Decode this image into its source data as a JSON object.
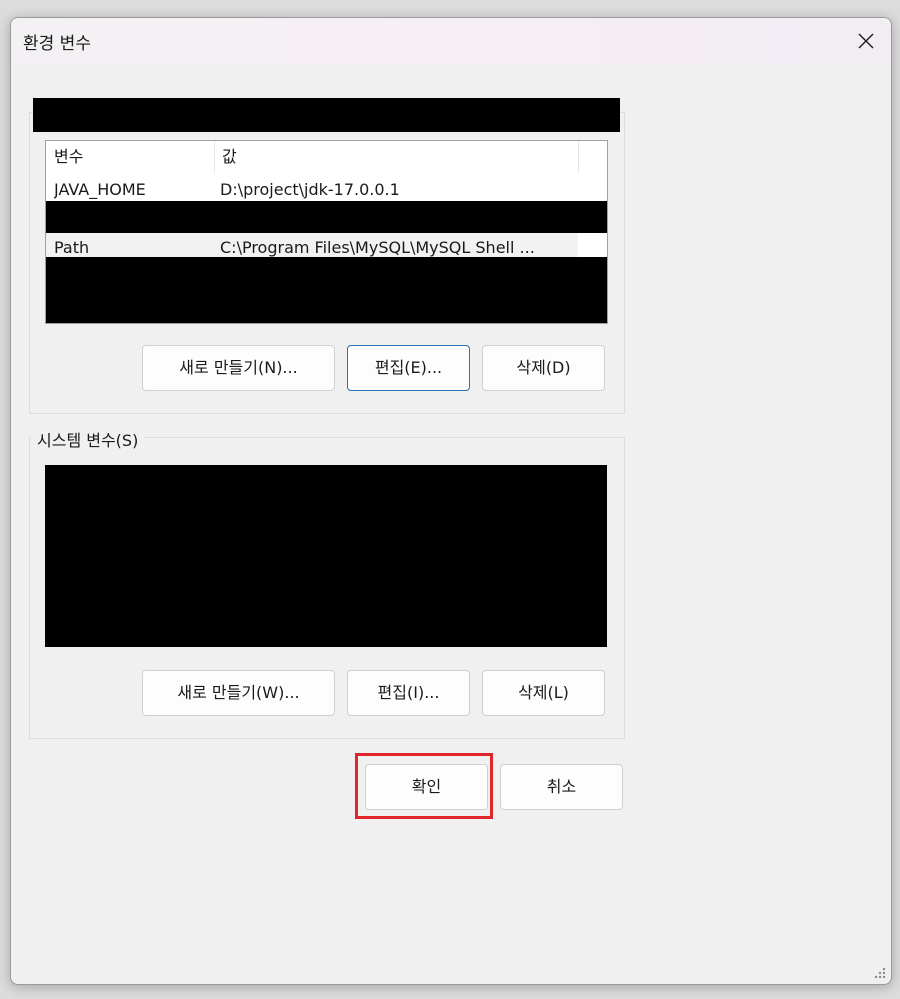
{
  "window": {
    "title": "환경 변수"
  },
  "user_vars": {
    "columns": [
      "변수",
      "값"
    ],
    "rows": [
      {
        "name": "JAVA_HOME",
        "value": "D:\\project\\jdk-17.0.0.1"
      },
      {
        "name": "Path",
        "value": "C:\\Program Files\\MySQL\\MySQL Shell ..."
      }
    ],
    "new_label": "새로 만들기(N)...",
    "edit_label": "편집(E)...",
    "delete_label": "삭제(D)"
  },
  "system_vars": {
    "group_title": "시스템 변수(S)",
    "new_label": "새로 만들기(W)...",
    "edit_label": "편집(I)...",
    "delete_label": "삭제(L)"
  },
  "footer": {
    "ok_label": "확인",
    "cancel_label": "취소"
  },
  "colors": {
    "highlight": "#e0262a",
    "focus_border": "#2f6fb8",
    "redaction": "#000000"
  }
}
